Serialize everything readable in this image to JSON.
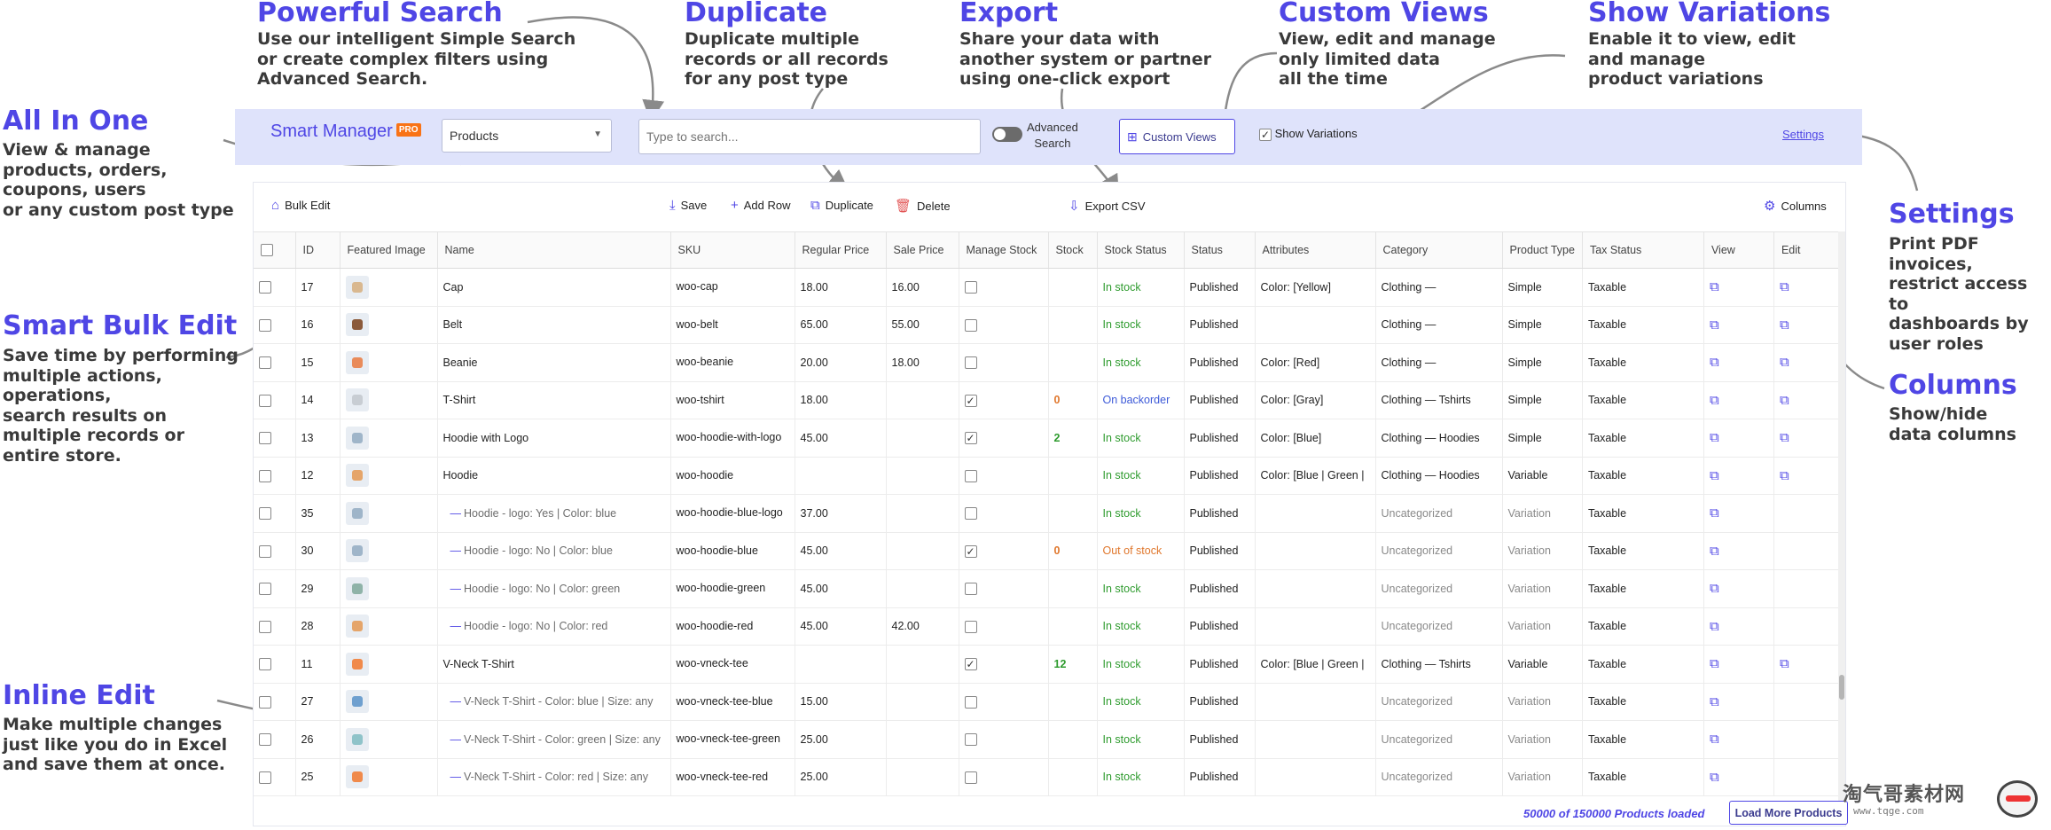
{
  "annotations": {
    "powerful_search": {
      "title": "Powerful Search",
      "desc": "Use our intelligent Simple Search\nor create complex filters using\nAdvanced Search."
    },
    "duplicate": {
      "title": "Duplicate",
      "desc": "Duplicate multiple\nrecords or all records\nfor any post type"
    },
    "export": {
      "title": "Export",
      "desc": "Share your data with\nanother system or partner\nusing one-click export"
    },
    "custom_views": {
      "title": "Custom Views",
      "desc": "View, edit and manage\nonly limited data\nall the time"
    },
    "show_variations": {
      "title": "Show Variations",
      "desc": "Enable it to view, edit\nand manage\nproduct variations"
    },
    "all_in_one": {
      "title": "All In One",
      "desc": "View & manage\nproducts, orders,\ncoupons, users\nor any custom post type"
    },
    "smart_bulk_edit": {
      "title": "Smart Bulk Edit",
      "desc": "Save time by performing\nmultiple actions,\noperations,\nsearch results on\nmultiple records or\nentire store."
    },
    "inline_edit": {
      "title": "Inline Edit",
      "desc": "Make multiple changes\njust like you do in Excel\nand save them at once."
    },
    "settings": {
      "title": "Settings",
      "desc": "Print PDF invoices,\nrestrict access to\ndashboards by\nuser roles"
    },
    "columns": {
      "title": "Columns",
      "desc": "Show/hide\ndata columns"
    }
  },
  "topbar": {
    "app_name": "Smart Manager",
    "pro_badge": "PRO",
    "post_type": "Products",
    "search_placeholder": "Type to search...",
    "advanced_search": "Advanced\nSearch",
    "custom_views": "Custom Views",
    "show_variations": "Show Variations",
    "settings": "Settings"
  },
  "toolbar": {
    "bulk_edit": "Bulk Edit",
    "save": "Save",
    "add_row": "Add Row",
    "duplicate": "Duplicate",
    "delete": "Delete",
    "export_csv": "Export CSV",
    "columns": "Columns"
  },
  "table": {
    "headers": [
      "",
      "ID",
      "Featured Image",
      "Name",
      "SKU",
      "Regular Price",
      "Sale Price",
      "Manage Stock",
      "Stock",
      "Stock Status",
      "Status",
      "Attributes",
      "Category",
      "Product Type",
      "Tax Status",
      "View",
      "Edit"
    ],
    "rows": [
      {
        "id": "17",
        "thumb": "#d9b890",
        "name": "Cap",
        "variation": false,
        "sku": "woo-cap",
        "regular": "18.00",
        "sale": "16.00",
        "manage": false,
        "stock": "",
        "stock_status": "In stock",
        "ss_color": "green",
        "status": "Published",
        "attributes": "Color: [Yellow]",
        "category": "Clothing —",
        "type": "Simple",
        "tax": "Taxable",
        "edit": true
      },
      {
        "id": "16",
        "thumb": "#8b5a3a",
        "name": "Belt",
        "variation": false,
        "sku": "woo-belt",
        "regular": "65.00",
        "sale": "55.00",
        "manage": false,
        "stock": "",
        "stock_status": "In stock",
        "ss_color": "green",
        "status": "Published",
        "attributes": "",
        "category": "Clothing —",
        "type": "Simple",
        "tax": "Taxable",
        "edit": true
      },
      {
        "id": "15",
        "thumb": "#e98b5a",
        "name": "Beanie",
        "variation": false,
        "sku": "woo-beanie",
        "regular": "20.00",
        "sale": "18.00",
        "manage": false,
        "stock": "",
        "stock_status": "In stock",
        "ss_color": "green",
        "status": "Published",
        "attributes": "Color: [Red]",
        "category": "Clothing —",
        "type": "Simple",
        "tax": "Taxable",
        "edit": true
      },
      {
        "id": "14",
        "thumb": "#c8cdd3",
        "name": "T-Shirt",
        "variation": false,
        "sku": "woo-tshirt",
        "regular": "18.00",
        "sale": "",
        "manage": true,
        "stock": "0",
        "stock_status": "On backorder",
        "ss_color": "blue",
        "status": "Published",
        "attributes": "Color: [Gray]",
        "category": "Clothing — Tshirts",
        "type": "Simple",
        "tax": "Taxable",
        "edit": true
      },
      {
        "id": "13",
        "thumb": "#9fb5c9",
        "name": "Hoodie with Logo",
        "variation": false,
        "sku": "woo-hoodie-with-logo",
        "regular": "45.00",
        "sale": "",
        "manage": true,
        "stock": "2",
        "stock_status": "In stock",
        "ss_color": "green",
        "status": "Published",
        "attributes": "Color: [Blue]",
        "category": "Clothing — Hoodies",
        "type": "Simple",
        "tax": "Taxable",
        "edit": true
      },
      {
        "id": "12",
        "thumb": "#e5a56a",
        "name": "Hoodie",
        "variation": false,
        "sku": "woo-hoodie",
        "regular": "",
        "sale": "",
        "manage": false,
        "stock": "",
        "stock_status": "In stock",
        "ss_color": "green",
        "status": "Published",
        "attributes": "Color: [Blue | Green |",
        "category": "Clothing — Hoodies",
        "type": "Variable",
        "tax": "Taxable",
        "edit": true
      },
      {
        "id": "35",
        "thumb": "#9fb5c9",
        "name": "Hoodie - logo: Yes | Color: blue",
        "variation": true,
        "sku": "woo-hoodie-blue-logo",
        "regular": "37.00",
        "sale": "",
        "manage": false,
        "stock": "",
        "stock_status": "In stock",
        "ss_color": "green",
        "status": "Published",
        "attributes": "",
        "category": "Uncategorized",
        "type": "Variation",
        "tax": "Taxable",
        "edit": false
      },
      {
        "id": "30",
        "thumb": "#9fb5c9",
        "name": "Hoodie - logo: No | Color: blue",
        "variation": true,
        "sku": "woo-hoodie-blue",
        "regular": "45.00",
        "sale": "",
        "manage": true,
        "stock": "0",
        "stock_status": "Out of stock",
        "ss_color": "orange",
        "status": "Published",
        "attributes": "",
        "category": "Uncategorized",
        "type": "Variation",
        "tax": "Taxable",
        "edit": false
      },
      {
        "id": "29",
        "thumb": "#8fb3a8",
        "name": "Hoodie - logo: No | Color: green",
        "variation": true,
        "sku": "woo-hoodie-green",
        "regular": "45.00",
        "sale": "",
        "manage": false,
        "stock": "",
        "stock_status": "In stock",
        "ss_color": "green",
        "status": "Published",
        "attributes": "",
        "category": "Uncategorized",
        "type": "Variation",
        "tax": "Taxable",
        "edit": false
      },
      {
        "id": "28",
        "thumb": "#e5a56a",
        "name": "Hoodie - logo: No | Color: red",
        "variation": true,
        "sku": "woo-hoodie-red",
        "regular": "45.00",
        "sale": "42.00",
        "manage": false,
        "stock": "",
        "stock_status": "In stock",
        "ss_color": "green",
        "status": "Published",
        "attributes": "",
        "category": "Uncategorized",
        "type": "Variation",
        "tax": "Taxable",
        "edit": false
      },
      {
        "id": "11",
        "thumb": "#f08a4b",
        "name": "V-Neck T-Shirt",
        "variation": false,
        "sku": "woo-vneck-tee",
        "regular": "",
        "sale": "",
        "manage": true,
        "stock": "12",
        "stock_status": "In stock",
        "ss_color": "green",
        "status": "Published",
        "attributes": "Color: [Blue | Green |",
        "category": "Clothing — Tshirts",
        "type": "Variable",
        "tax": "Taxable",
        "edit": true
      },
      {
        "id": "27",
        "thumb": "#6fa0cf",
        "name": "V-Neck T-Shirt - Color: blue | Size: any",
        "variation": true,
        "sku": "woo-vneck-tee-blue",
        "regular": "15.00",
        "sale": "",
        "manage": false,
        "stock": "",
        "stock_status": "In stock",
        "ss_color": "green",
        "status": "Published",
        "attributes": "",
        "category": "Uncategorized",
        "type": "Variation",
        "tax": "Taxable",
        "edit": false
      },
      {
        "id": "26",
        "thumb": "#8fc3c9",
        "name": "V-Neck T-Shirt - Color: green | Size: any",
        "variation": true,
        "sku": "woo-vneck-tee-green",
        "regular": "25.00",
        "sale": "",
        "manage": false,
        "stock": "",
        "stock_status": "In stock",
        "ss_color": "green",
        "status": "Published",
        "attributes": "",
        "category": "Uncategorized",
        "type": "Variation",
        "tax": "Taxable",
        "edit": false
      },
      {
        "id": "25",
        "thumb": "#f08a4b",
        "name": "V-Neck T-Shirt - Color: red | Size: any",
        "variation": true,
        "sku": "woo-vneck-tee-red",
        "regular": "25.00",
        "sale": "",
        "manage": false,
        "stock": "",
        "stock_status": "In stock",
        "ss_color": "green",
        "status": "Published",
        "attributes": "",
        "category": "Uncategorized",
        "type": "Variation",
        "tax": "Taxable",
        "edit": false
      }
    ]
  },
  "footer": {
    "status": "50000 of 150000 Products loaded",
    "load_more": "Load More Products"
  },
  "watermark": {
    "text": "淘气哥素材网",
    "url": "www.tqge.com"
  },
  "colors": {
    "accent": "#4f46e5",
    "topbar_bg": "#dfe3fb",
    "in_stock": "#2e9b2e",
    "out_of_stock": "#e0772c",
    "backorder": "#3d5ad8"
  }
}
